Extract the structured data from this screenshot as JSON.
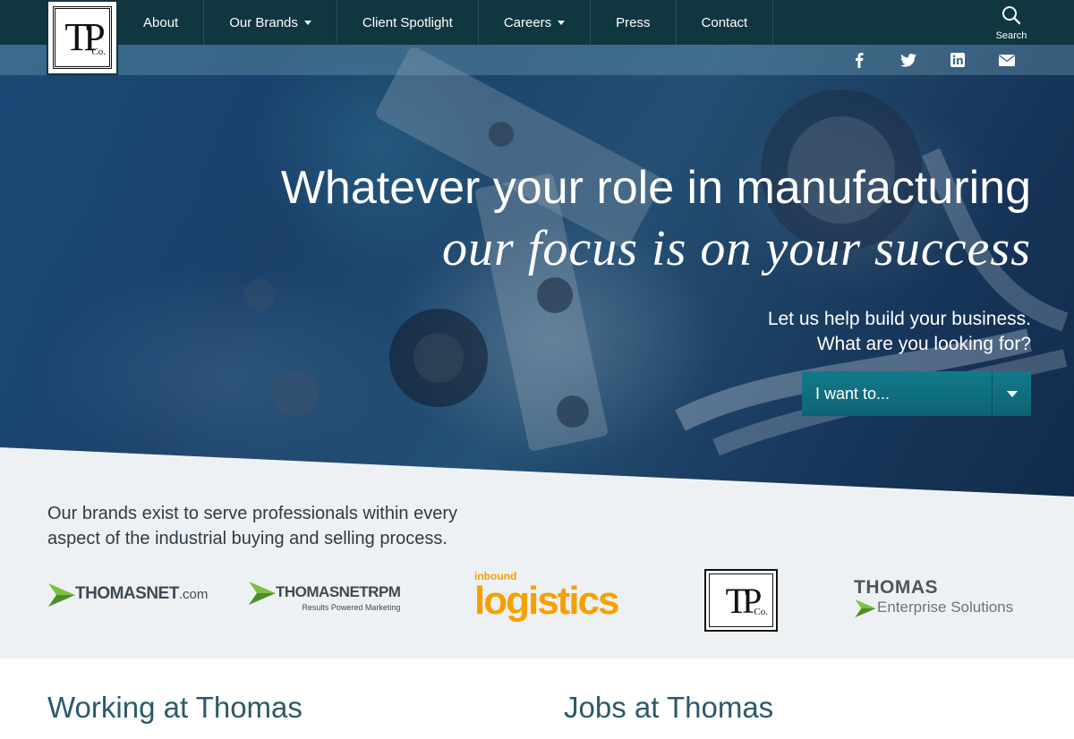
{
  "logo": {
    "letters": "TP",
    "suffix": "Co."
  },
  "nav": {
    "items": [
      {
        "label": "About",
        "has_caret": false
      },
      {
        "label": "Our Brands",
        "has_caret": true
      },
      {
        "label": "Client Spotlight",
        "has_caret": false
      },
      {
        "label": "Careers",
        "has_caret": true
      },
      {
        "label": "Press",
        "has_caret": false
      },
      {
        "label": "Contact",
        "has_caret": false
      }
    ],
    "search_label": "Search"
  },
  "social": [
    "facebook-icon",
    "twitter-icon",
    "linkedin-icon",
    "email-icon"
  ],
  "hero": {
    "headline": "Whatever your role in manufacturing",
    "tagline": "our focus is on your success",
    "help_line1": "Let us help build your business.",
    "help_line2": "What are you looking for?",
    "dropdown_value": "I want to..."
  },
  "brands": {
    "intro": "Our brands exist to serve professionals within every aspect of the industrial buying and selling process.",
    "thomasnet": {
      "word": "THOMASNET",
      "suffix": ".com"
    },
    "rpm": {
      "word": "THOMASNET",
      "accent": "RPM",
      "sub": "Results Powered Marketing"
    },
    "inbound": {
      "small": "inbound",
      "big": "logistics"
    },
    "tpc": {
      "letters": "TP",
      "suffix": "Co."
    },
    "enterprise": {
      "top": "THOMAS",
      "bottom": "Enterprise Solutions"
    }
  },
  "sections": {
    "working": "Working at Thomas",
    "jobs": "Jobs at Thomas"
  },
  "colors": {
    "nav_bg": "#10363f",
    "accent_teal": "#137a8a",
    "title_teal": "#2b5a6a",
    "logistics_orange": "#f4a100",
    "chevron_green": "#7bc142"
  }
}
